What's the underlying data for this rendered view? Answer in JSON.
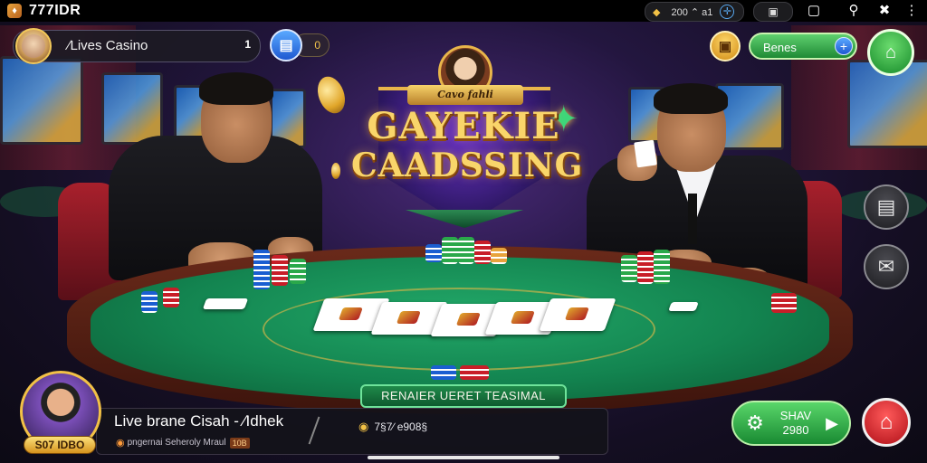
{
  "status_bar": {
    "app_title": "777IDR",
    "signal_text": "200 ⌃ a1",
    "icons": [
      "app-logo-icon",
      "signal-icon",
      "compass-icon",
      "camera-icon",
      "square-icon",
      "search-icon",
      "close-icon",
      "more-icon"
    ]
  },
  "top_bar": {
    "player_label": "∕Lives Casino",
    "player_count": "1",
    "chip_value": "0",
    "bonus_label": "Benes",
    "bonus_plus": "+"
  },
  "logo": {
    "banner": "Cavo fahli",
    "line1": "GAYEKIE",
    "line2": "CAADSSING"
  },
  "table": {
    "placard": "RENAIER UERET TEASIMAL"
  },
  "streamer": {
    "badge": "S07 IDBO",
    "title": "Live brane Cisah - ∕Idhek",
    "location": "pngernai Seheroly Mraul",
    "location_tag": "10B",
    "viewers": "7§7∕ e908§"
  },
  "play_button": {
    "label_top": "SHAV",
    "label_bottom": "2980"
  },
  "colors": {
    "accent_green": "#1f8a35",
    "accent_gold": "#f2c146",
    "felt": "#138450",
    "home_red": "#b01018"
  }
}
